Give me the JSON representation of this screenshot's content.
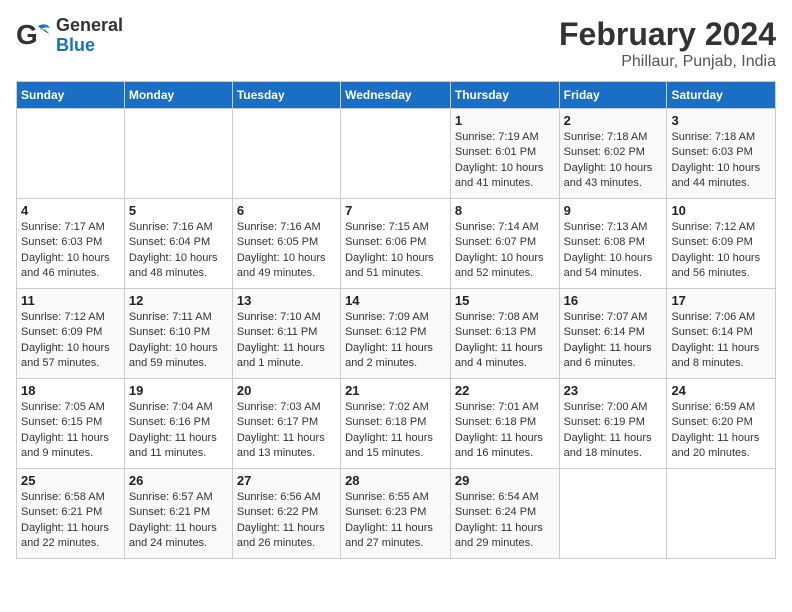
{
  "logo": {
    "general": "General",
    "blue": "Blue"
  },
  "title": "February 2024",
  "subtitle": "Phillaur, Punjab, India",
  "days_of_week": [
    "Sunday",
    "Monday",
    "Tuesday",
    "Wednesday",
    "Thursday",
    "Friday",
    "Saturday"
  ],
  "weeks": [
    [
      {
        "day": "",
        "info": ""
      },
      {
        "day": "",
        "info": ""
      },
      {
        "day": "",
        "info": ""
      },
      {
        "day": "",
        "info": ""
      },
      {
        "day": "1",
        "info": "Sunrise: 7:19 AM\nSunset: 6:01 PM\nDaylight: 10 hours and 41 minutes."
      },
      {
        "day": "2",
        "info": "Sunrise: 7:18 AM\nSunset: 6:02 PM\nDaylight: 10 hours and 43 minutes."
      },
      {
        "day": "3",
        "info": "Sunrise: 7:18 AM\nSunset: 6:03 PM\nDaylight: 10 hours and 44 minutes."
      }
    ],
    [
      {
        "day": "4",
        "info": "Sunrise: 7:17 AM\nSunset: 6:03 PM\nDaylight: 10 hours and 46 minutes."
      },
      {
        "day": "5",
        "info": "Sunrise: 7:16 AM\nSunset: 6:04 PM\nDaylight: 10 hours and 48 minutes."
      },
      {
        "day": "6",
        "info": "Sunrise: 7:16 AM\nSunset: 6:05 PM\nDaylight: 10 hours and 49 minutes."
      },
      {
        "day": "7",
        "info": "Sunrise: 7:15 AM\nSunset: 6:06 PM\nDaylight: 10 hours and 51 minutes."
      },
      {
        "day": "8",
        "info": "Sunrise: 7:14 AM\nSunset: 6:07 PM\nDaylight: 10 hours and 52 minutes."
      },
      {
        "day": "9",
        "info": "Sunrise: 7:13 AM\nSunset: 6:08 PM\nDaylight: 10 hours and 54 minutes."
      },
      {
        "day": "10",
        "info": "Sunrise: 7:12 AM\nSunset: 6:09 PM\nDaylight: 10 hours and 56 minutes."
      }
    ],
    [
      {
        "day": "11",
        "info": "Sunrise: 7:12 AM\nSunset: 6:09 PM\nDaylight: 10 hours and 57 minutes."
      },
      {
        "day": "12",
        "info": "Sunrise: 7:11 AM\nSunset: 6:10 PM\nDaylight: 10 hours and 59 minutes."
      },
      {
        "day": "13",
        "info": "Sunrise: 7:10 AM\nSunset: 6:11 PM\nDaylight: 11 hours and 1 minute."
      },
      {
        "day": "14",
        "info": "Sunrise: 7:09 AM\nSunset: 6:12 PM\nDaylight: 11 hours and 2 minutes."
      },
      {
        "day": "15",
        "info": "Sunrise: 7:08 AM\nSunset: 6:13 PM\nDaylight: 11 hours and 4 minutes."
      },
      {
        "day": "16",
        "info": "Sunrise: 7:07 AM\nSunset: 6:14 PM\nDaylight: 11 hours and 6 minutes."
      },
      {
        "day": "17",
        "info": "Sunrise: 7:06 AM\nSunset: 6:14 PM\nDaylight: 11 hours and 8 minutes."
      }
    ],
    [
      {
        "day": "18",
        "info": "Sunrise: 7:05 AM\nSunset: 6:15 PM\nDaylight: 11 hours and 9 minutes."
      },
      {
        "day": "19",
        "info": "Sunrise: 7:04 AM\nSunset: 6:16 PM\nDaylight: 11 hours and 11 minutes."
      },
      {
        "day": "20",
        "info": "Sunrise: 7:03 AM\nSunset: 6:17 PM\nDaylight: 11 hours and 13 minutes."
      },
      {
        "day": "21",
        "info": "Sunrise: 7:02 AM\nSunset: 6:18 PM\nDaylight: 11 hours and 15 minutes."
      },
      {
        "day": "22",
        "info": "Sunrise: 7:01 AM\nSunset: 6:18 PM\nDaylight: 11 hours and 16 minutes."
      },
      {
        "day": "23",
        "info": "Sunrise: 7:00 AM\nSunset: 6:19 PM\nDaylight: 11 hours and 18 minutes."
      },
      {
        "day": "24",
        "info": "Sunrise: 6:59 AM\nSunset: 6:20 PM\nDaylight: 11 hours and 20 minutes."
      }
    ],
    [
      {
        "day": "25",
        "info": "Sunrise: 6:58 AM\nSunset: 6:21 PM\nDaylight: 11 hours and 22 minutes."
      },
      {
        "day": "26",
        "info": "Sunrise: 6:57 AM\nSunset: 6:21 PM\nDaylight: 11 hours and 24 minutes."
      },
      {
        "day": "27",
        "info": "Sunrise: 6:56 AM\nSunset: 6:22 PM\nDaylight: 11 hours and 26 minutes."
      },
      {
        "day": "28",
        "info": "Sunrise: 6:55 AM\nSunset: 6:23 PM\nDaylight: 11 hours and 27 minutes."
      },
      {
        "day": "29",
        "info": "Sunrise: 6:54 AM\nSunset: 6:24 PM\nDaylight: 11 hours and 29 minutes."
      },
      {
        "day": "",
        "info": ""
      },
      {
        "day": "",
        "info": ""
      }
    ]
  ]
}
